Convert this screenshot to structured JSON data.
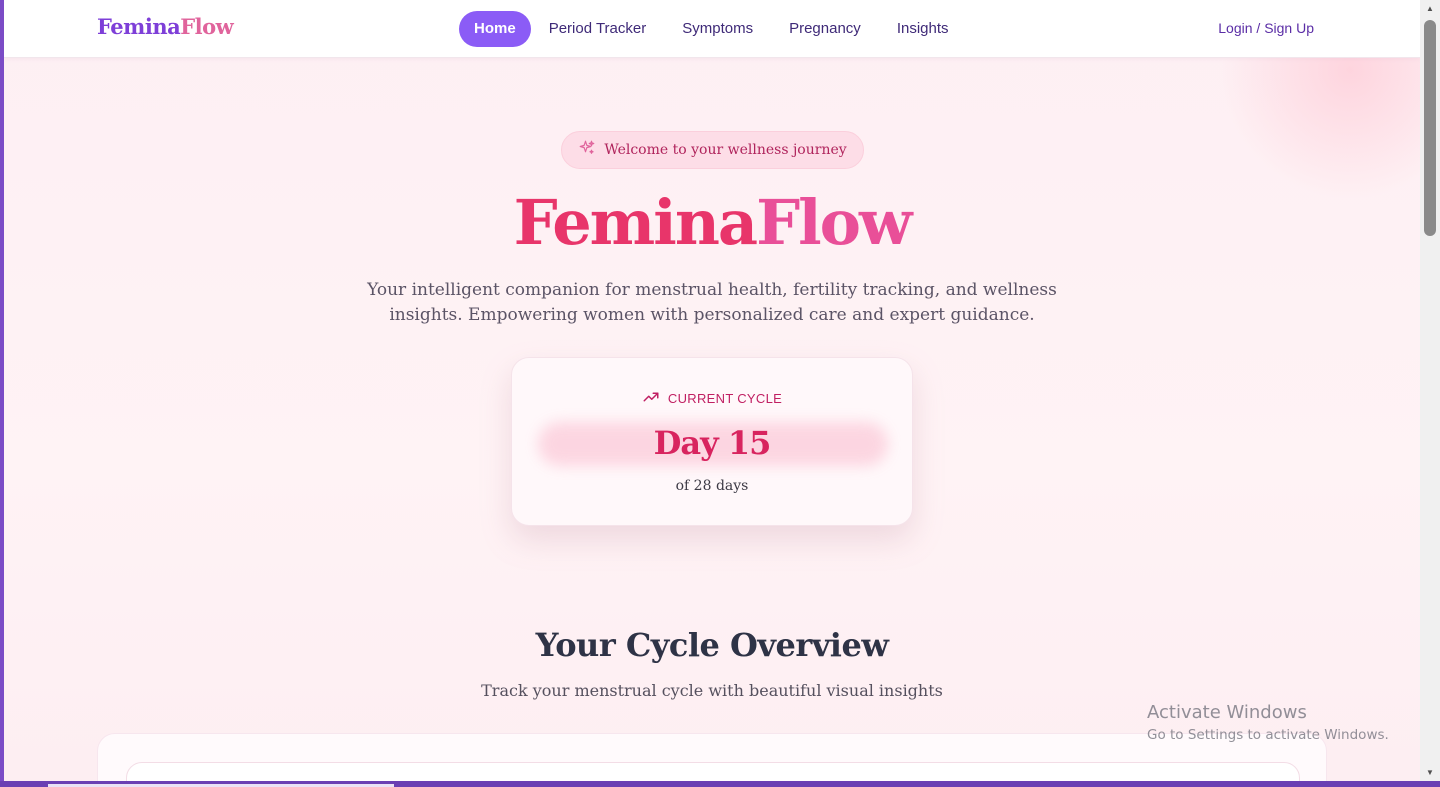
{
  "header": {
    "brand_part1": "Femina",
    "brand_part2": "Flow",
    "nav": [
      {
        "label": "Home",
        "active": true
      },
      {
        "label": "Period Tracker",
        "active": false
      },
      {
        "label": "Symptoms",
        "active": false
      },
      {
        "label": "Pregnancy",
        "active": false
      },
      {
        "label": "Insights",
        "active": false
      }
    ],
    "login_label": "Login / Sign Up"
  },
  "hero": {
    "badge_icon": "sparkles-icon",
    "badge_text": "Welcome to your wellness journey",
    "title_part1": "Femina",
    "title_part2": "Flow",
    "subtitle": "Your intelligent companion for menstrual health, fertility tracking, and wellness insights. Empowering women with personalized care and expert guidance."
  },
  "cycle_card": {
    "icon": "trending-up-icon",
    "label": "CURRENT CYCLE",
    "day": "Day 15",
    "of_days": "of 28 days"
  },
  "overview": {
    "title": "Your Cycle Overview",
    "subtitle": "Track your menstrual cycle with beautiful visual insights"
  },
  "os_watermark": {
    "line1": "Activate Windows",
    "line2": "Go to Settings to activate Windows."
  },
  "colors": {
    "accent_purple": "#8b5cf6",
    "brand_pink": "#e8356a",
    "background": "#fdeff3"
  }
}
